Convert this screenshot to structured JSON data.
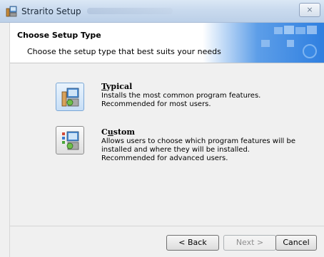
{
  "window": {
    "title": "Strarito Setup",
    "close_glyph": "⨯"
  },
  "header": {
    "title": "Choose Setup Type",
    "subtitle": "Choose the setup type that best suits your needs"
  },
  "options": [
    {
      "title": "Typical",
      "mnemonic": "T",
      "title_rest": "ypical",
      "description": "Installs the most common program features. Recommended for most users.",
      "icon": "computer-setup-icon"
    },
    {
      "title": "Custom",
      "mnemonic_prefix": "C",
      "mnemonic": "u",
      "title_rest": "stom",
      "description": "Allows users to choose which program features will be installed and where they will be installed. Recommended for advanced users.",
      "icon": "custom-setup-icon"
    }
  ],
  "buttons": {
    "back": "< Back",
    "next": "Next >",
    "cancel": "Cancel"
  },
  "colors": {
    "titlebar": "#c9daee",
    "content_bg": "#f0f0f0",
    "selected_border": "#7aa7d6"
  }
}
